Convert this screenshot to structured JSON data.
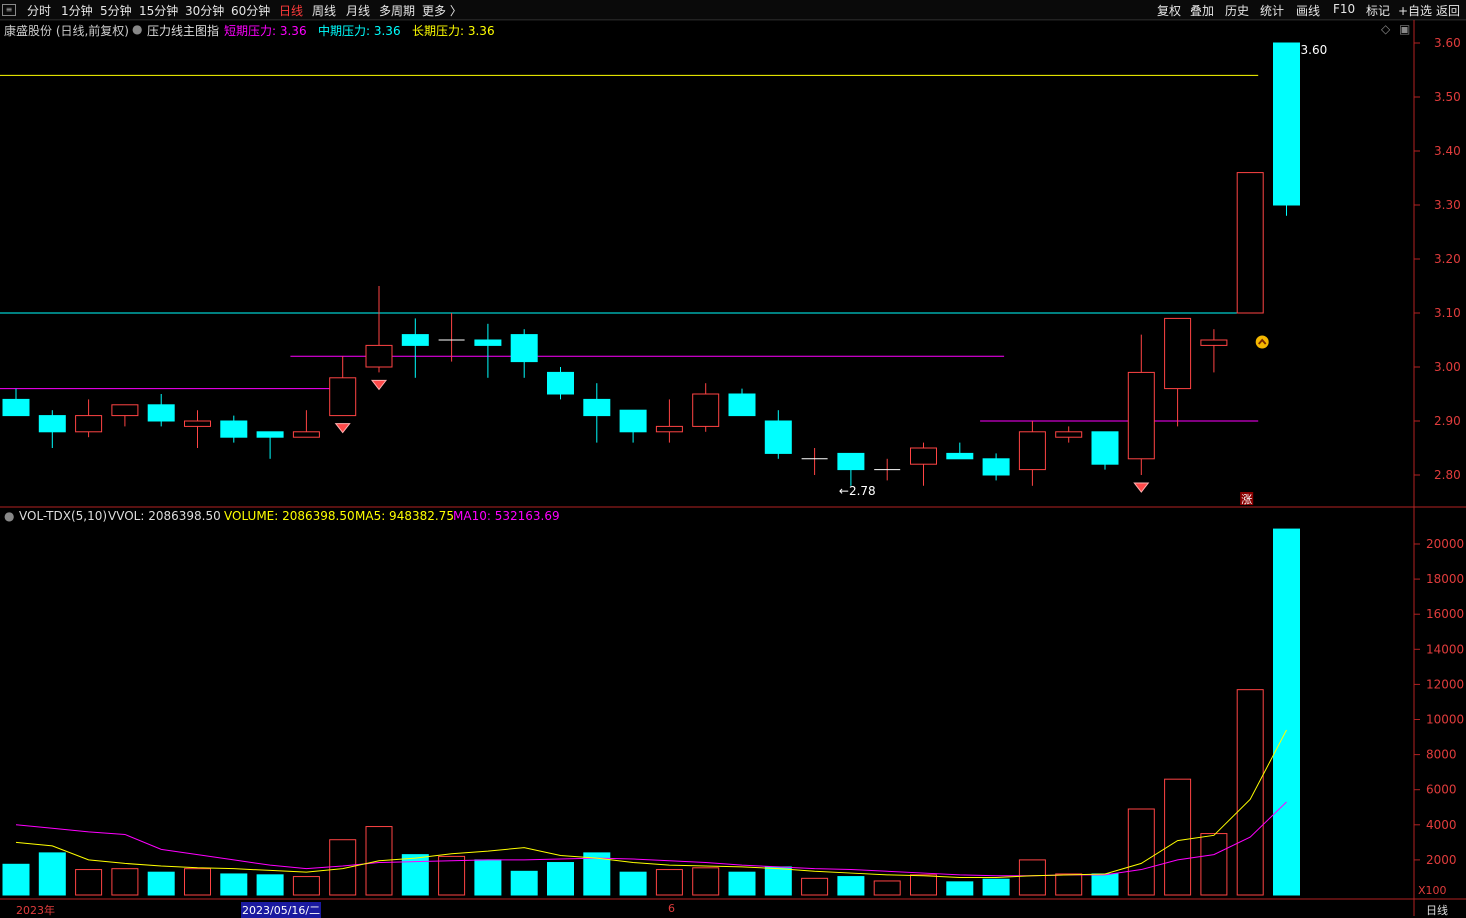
{
  "toolbar": {
    "left_items": [
      "分时",
      "1分钟",
      "5分钟",
      "15分钟",
      "30分钟",
      "60分钟",
      "日线",
      "周线",
      "月线",
      "多周期",
      "更多 〉"
    ],
    "active_index": 6,
    "right_items": [
      "复权",
      "叠加",
      "历史",
      "统计",
      "画线",
      "F10",
      "标记",
      "+自选",
      "返回"
    ]
  },
  "main_panel": {
    "stock_title": "康盛股份 (日线,前复权)",
    "indicator_name": "压力线主图指",
    "short_pressure": "短期压力: 3.36",
    "mid_pressure": "中期压力: 3.36",
    "long_pressure": "长期压力: 3.36",
    "high_marker": "3.60",
    "low_marker": "←2.78",
    "zhang_badge": "涨",
    "y_ticks": [
      "3.60",
      "3.50",
      "3.40",
      "3.30",
      "3.20",
      "3.10",
      "3.00",
      "2.90",
      "2.80"
    ]
  },
  "volume_panel": {
    "indicator": "VOL-TDX(5,10)",
    "vvol": "VVOL: 2086398.50",
    "volume": "VOLUME: 2086398.50",
    "ma5": "MA5: 948382.75",
    "ma10": "MA10: 532163.69",
    "y_ticks": [
      "20000",
      "18000",
      "16000",
      "14000",
      "12000",
      "10000",
      "8000",
      "6000",
      "4000",
      "2000"
    ],
    "unit": "X100"
  },
  "date_axis": {
    "year_label": "2023年",
    "cursor_date": "2023/05/16/二",
    "month_label": "6",
    "period_label": "日线"
  },
  "colors": {
    "up": "#ff4444",
    "down": "#00ffff",
    "short_line": "#ff00ff",
    "mid_line": "#00ffff",
    "long_line": "#ffff00",
    "axis": "#b22222"
  },
  "chart_data": {
    "type": "candlestick",
    "price_range": [
      2.75,
      3.62
    ],
    "volume_range": [
      0,
      21500
    ],
    "candles": [
      {
        "o": 2.94,
        "h": 2.96,
        "l": 2.91,
        "c": 2.91
      },
      {
        "o": 2.91,
        "h": 2.92,
        "l": 2.85,
        "c": 2.88
      },
      {
        "o": 2.88,
        "h": 2.94,
        "l": 2.87,
        "c": 2.91
      },
      {
        "o": 2.91,
        "h": 2.93,
        "l": 2.89,
        "c": 2.93
      },
      {
        "o": 2.93,
        "h": 2.95,
        "l": 2.89,
        "c": 2.9
      },
      {
        "o": 2.89,
        "h": 2.92,
        "l": 2.85,
        "c": 2.9
      },
      {
        "o": 2.9,
        "h": 2.91,
        "l": 2.86,
        "c": 2.87
      },
      {
        "o": 2.88,
        "h": 2.88,
        "l": 2.83,
        "c": 2.87
      },
      {
        "o": 2.87,
        "h": 2.92,
        "l": 2.87,
        "c": 2.88
      },
      {
        "o": 2.91,
        "h": 3.02,
        "l": 2.91,
        "c": 2.98
      },
      {
        "o": 3.0,
        "h": 3.15,
        "l": 2.99,
        "c": 3.04
      },
      {
        "o": 3.06,
        "h": 3.09,
        "l": 2.98,
        "c": 3.04
      },
      {
        "o": 3.05,
        "h": 3.1,
        "l": 3.01,
        "c": 3.05
      },
      {
        "o": 3.05,
        "h": 3.08,
        "l": 2.98,
        "c": 3.04
      },
      {
        "o": 3.06,
        "h": 3.07,
        "l": 2.98,
        "c": 3.01
      },
      {
        "o": 2.99,
        "h": 3.0,
        "l": 2.94,
        "c": 2.95
      },
      {
        "o": 2.94,
        "h": 2.97,
        "l": 2.86,
        "c": 2.91
      },
      {
        "o": 2.92,
        "h": 2.92,
        "l": 2.86,
        "c": 2.88
      },
      {
        "o": 2.88,
        "h": 2.94,
        "l": 2.86,
        "c": 2.89
      },
      {
        "o": 2.89,
        "h": 2.97,
        "l": 2.88,
        "c": 2.95
      },
      {
        "o": 2.95,
        "h": 2.96,
        "l": 2.91,
        "c": 2.91
      },
      {
        "o": 2.9,
        "h": 2.92,
        "l": 2.83,
        "c": 2.84
      },
      {
        "o": 2.83,
        "h": 2.85,
        "l": 2.8,
        "c": 2.83
      },
      {
        "o": 2.84,
        "h": 2.84,
        "l": 2.78,
        "c": 2.81
      },
      {
        "o": 2.81,
        "h": 2.83,
        "l": 2.79,
        "c": 2.81
      },
      {
        "o": 2.82,
        "h": 2.86,
        "l": 2.78,
        "c": 2.85
      },
      {
        "o": 2.84,
        "h": 2.86,
        "l": 2.83,
        "c": 2.83
      },
      {
        "o": 2.83,
        "h": 2.84,
        "l": 2.79,
        "c": 2.8
      },
      {
        "o": 2.81,
        "h": 2.9,
        "l": 2.78,
        "c": 2.88
      },
      {
        "o": 2.87,
        "h": 2.89,
        "l": 2.86,
        "c": 2.88
      },
      {
        "o": 2.88,
        "h": 2.88,
        "l": 2.81,
        "c": 2.82
      },
      {
        "o": 2.83,
        "h": 3.06,
        "l": 2.8,
        "c": 2.99
      },
      {
        "o": 2.96,
        "h": 3.09,
        "l": 2.89,
        "c": 3.09
      },
      {
        "o": 3.04,
        "h": 3.07,
        "l": 2.99,
        "c": 3.05
      },
      {
        "o": 3.1,
        "h": 3.36,
        "l": 3.1,
        "c": 3.36
      },
      {
        "o": 3.6,
        "h": 3.6,
        "l": 3.28,
        "c": 3.3
      }
    ],
    "volumes": [
      1750,
      2400,
      1450,
      1500,
      1300,
      1500,
      1200,
      1150,
      1050,
      3150,
      3900,
      2300,
      2200,
      2000,
      1350,
      1850,
      2400,
      1300,
      1450,
      1550,
      1300,
      1600,
      950,
      1050,
      800,
      1150,
      750,
      900,
      2000,
      1200,
      1200,
      4900,
      6600,
      3500,
      11700,
      20850
    ],
    "ma5": [
      3000,
      2800,
      2000,
      1800,
      1650,
      1550,
      1500,
      1400,
      1300,
      1500,
      1950,
      2100,
      2350,
      2500,
      2700,
      2250,
      2100,
      1850,
      1700,
      1650,
      1600,
      1500,
      1350,
      1250,
      1150,
      1100,
      1000,
      1000,
      1100,
      1150,
      1200,
      1800,
      3100,
      3400,
      5450,
      9400
    ],
    "ma10": [
      4000,
      3800,
      3600,
      3450,
      2600,
      2300,
      2000,
      1700,
      1500,
      1650,
      1850,
      1900,
      1950,
      2000,
      2000,
      2050,
      2100,
      2050,
      1950,
      1850,
      1700,
      1600,
      1500,
      1450,
      1350,
      1250,
      1150,
      1100,
      1100,
      1150,
      1150,
      1450,
      2000,
      2300,
      3300,
      5300
    ],
    "pressure_lines": [
      {
        "name": "短期压力",
        "segments": [
          {
            "from": 0,
            "to": 9,
            "price": 2.96
          },
          {
            "from": 8,
            "to": 27,
            "price": 3.02
          },
          {
            "from": 27,
            "to": 34,
            "price": 2.9
          }
        ]
      },
      {
        "name": "中期压力",
        "segments": [
          {
            "from": 0,
            "to": 34,
            "price": 3.1
          }
        ]
      },
      {
        "name": "长期压力",
        "segments": [
          {
            "from": 0,
            "to": 34,
            "price": 3.54
          }
        ]
      }
    ],
    "signal_down": [
      9,
      10,
      31
    ],
    "signal_up": [
      34
    ]
  }
}
